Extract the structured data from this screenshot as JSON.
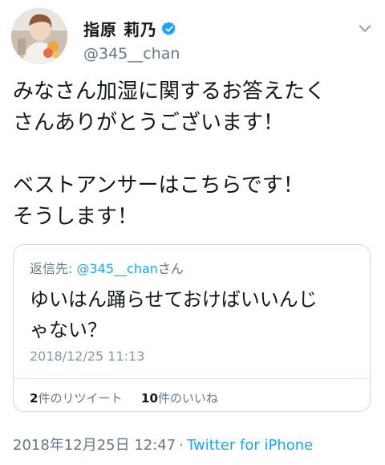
{
  "author": {
    "display_name": "指原 莉乃",
    "handle": "@345__chan",
    "verified": true
  },
  "tweet": {
    "lines": [
      "みなさん加湿に関するお答えたく",
      "さんありがとうございます！",
      "",
      "ベストアンサーはこちらです！",
      "そうします！"
    ]
  },
  "quoted": {
    "reply_prefix": "返信先: ",
    "reply_handle": "@345__chan",
    "reply_suffix": "さん",
    "lines": [
      "ゆいはん踊らせておけばいいんじ",
      "ゃない？"
    ],
    "timestamp": "2018/12/25 11:13",
    "retweet_count": "2",
    "retweet_label": "件のリツイート",
    "like_count": "10",
    "like_label": "件のいいね"
  },
  "footer": {
    "timestamp": "2018年12月25日 12:47",
    "separator": "·",
    "client": "Twitter for iPhone"
  },
  "icons": {
    "verified": "verified-badge-icon",
    "menu": "chevron-down-icon"
  },
  "colors": {
    "accent": "#1da1f2",
    "secondary_text": "#657786",
    "border": "#cfd9de"
  }
}
